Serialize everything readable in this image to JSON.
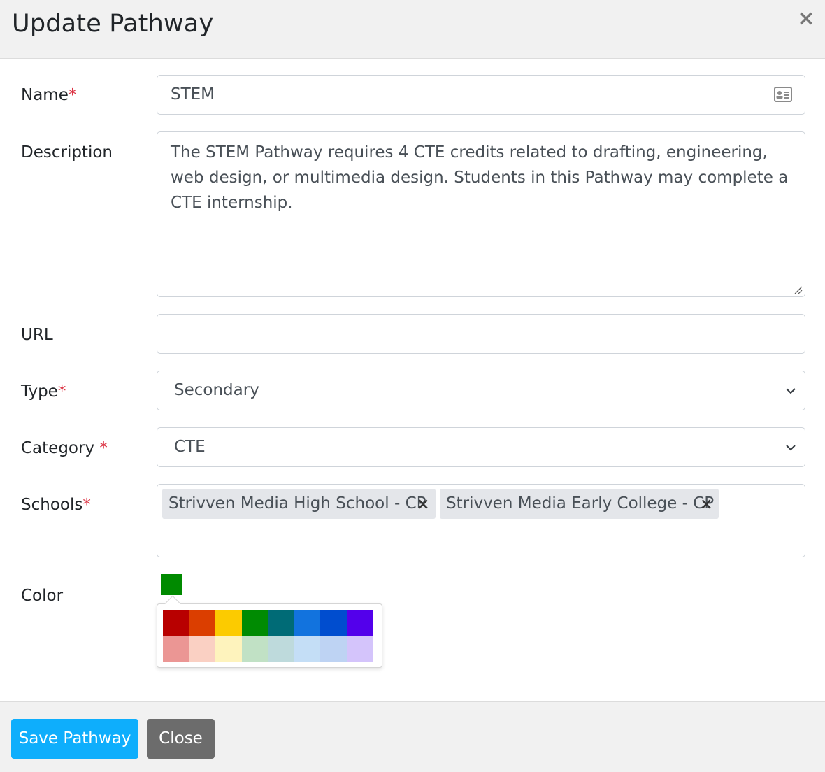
{
  "header": {
    "title": "Update Pathway",
    "close_glyph": "×"
  },
  "form": {
    "name": {
      "label": "Name",
      "required_mark": "*",
      "value": "STEM",
      "icon": "id-card-icon"
    },
    "description": {
      "label": "Description",
      "value": "The STEM Pathway requires 4 CTE credits related to drafting, engineering, web design, or multimedia design. Students in this Pathway may complete a CTE internship."
    },
    "url": {
      "label": "URL",
      "value": ""
    },
    "type": {
      "label": "Type",
      "required_mark": "*",
      "value": "Secondary"
    },
    "category": {
      "label": "Category ",
      "required_mark": "*",
      "value": "CTE"
    },
    "schools": {
      "label": "Schools",
      "required_mark": "*",
      "selected": [
        "Strivven Media High School - CP",
        "Strivven Media Early College - CP"
      ],
      "remove_glyph": "×"
    },
    "color": {
      "label": "Color",
      "selected": "#008a00",
      "palette": [
        "#b80000",
        "#db3e00",
        "#fccb00",
        "#008b02",
        "#006b76",
        "#1273de",
        "#004dcf",
        "#5300eb",
        "#eb9694",
        "#fad0c3",
        "#fef3bd",
        "#c1e1c5",
        "#bedadc",
        "#c4def6",
        "#bed3f3",
        "#d4c4fb"
      ]
    }
  },
  "footer": {
    "save_label": "Save Pathway",
    "close_label": "Close"
  },
  "colors": {
    "primary": "#0eaefc",
    "secondary": "#6c6c6c",
    "required": "#dc3545"
  }
}
